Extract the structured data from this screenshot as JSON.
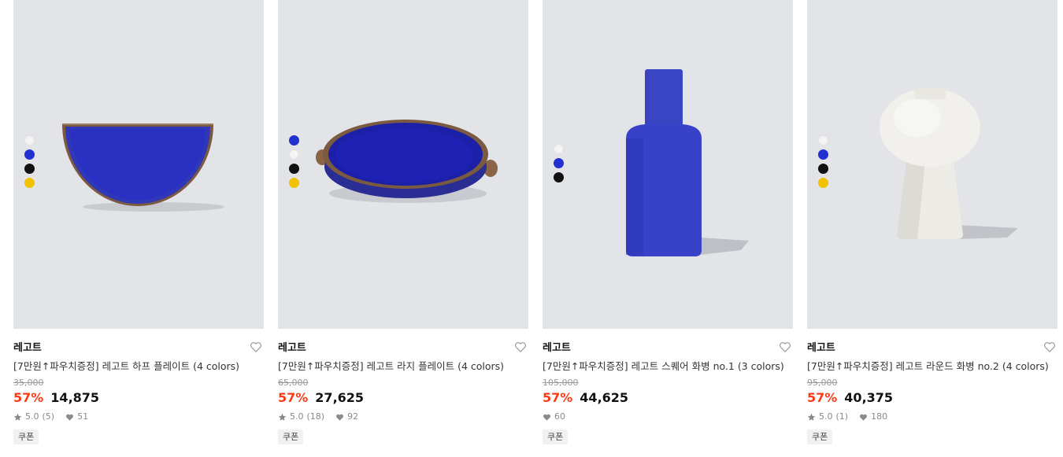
{
  "products": [
    {
      "brand": "레고트",
      "title": "[7만원↑파우치증정] 레고트 하프 플레이트 (4 colors)",
      "original_price": "35,000",
      "discount": "57%",
      "price": "14,875",
      "rating": "5.0",
      "review_count": "(5)",
      "likes": "51",
      "tag": "쿠폰",
      "swatches": [
        "#f4f4f2",
        "#2230d0",
        "#111111",
        "#f2c200"
      ],
      "icons": [
        "star-icon",
        "heart-icon"
      ]
    },
    {
      "brand": "레고트",
      "title": "[7만원↑파우치증정] 레고트 라지 플레이트 (4 colors)",
      "original_price": "65,000",
      "discount": "57%",
      "price": "27,625",
      "rating": "5.0",
      "review_count": "(18)",
      "likes": "92",
      "tag": "쿠폰",
      "swatches": [
        "#2230d0",
        "#f4f4f2",
        "#111111",
        "#f2c200"
      ],
      "icons": [
        "star-icon",
        "heart-icon"
      ]
    },
    {
      "brand": "레고트",
      "title": "[7만원↑파우치증정] 레고트 스퀘어 화병 no.1 (3 colors)",
      "original_price": "105,000",
      "discount": "57%",
      "price": "44,625",
      "rating": "",
      "review_count": "",
      "likes": "60",
      "tag": "쿠폰",
      "swatches": [
        "#f4f4f2",
        "#2230d0",
        "#111111"
      ],
      "icons": [
        "heart-icon"
      ]
    },
    {
      "brand": "레고트",
      "title": "[7만원↑파우치증정] 레고트 라운드 화병 no.2 (4 colors)",
      "original_price": "95,000",
      "discount": "57%",
      "price": "40,375",
      "rating": "5.0",
      "review_count": "(1)",
      "likes": "180",
      "tag": "쿠폰",
      "swatches": [
        "#f4f4f2",
        "#2230d0",
        "#111111",
        "#f2c200"
      ],
      "icons": [
        "star-icon",
        "heart-icon"
      ]
    }
  ],
  "colors": {
    "discount": "#ff3a19",
    "thumb_bg": "#e3e4e8",
    "cobalt": "#2a33c8"
  }
}
